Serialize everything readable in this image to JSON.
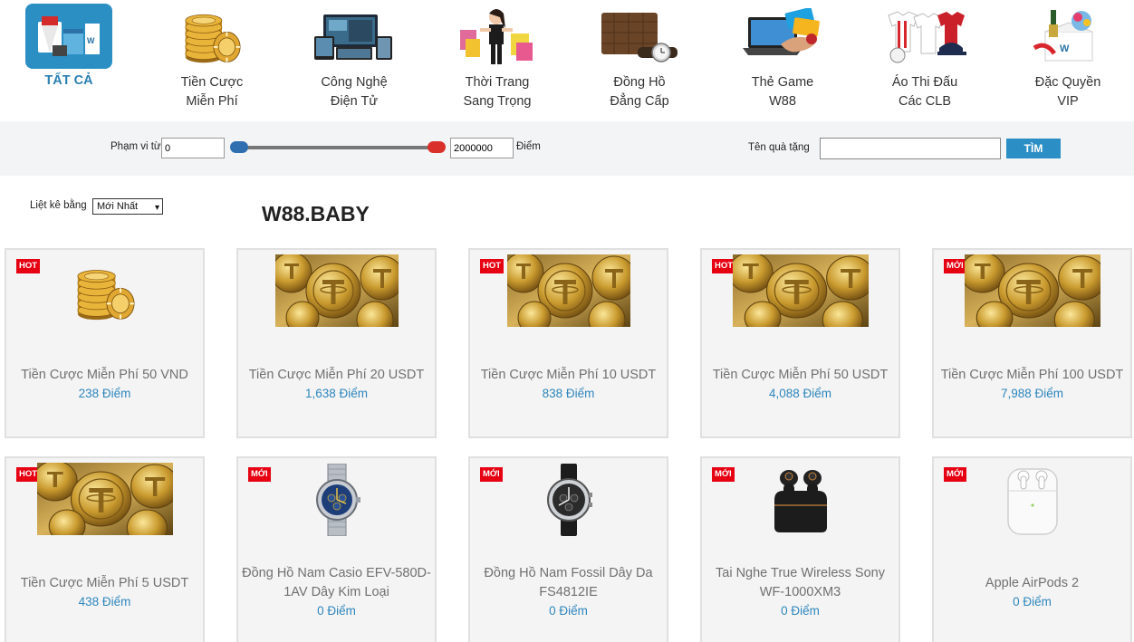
{
  "categories": [
    {
      "label": "TẤT CẢ",
      "icon": "all-gifts-icon",
      "active": true
    },
    {
      "label": "Tiền Cược Miễn Phí",
      "icon": "casino-chips-icon",
      "active": false
    },
    {
      "label": "Công Nghệ Điện Tử",
      "icon": "electronics-icon",
      "active": false
    },
    {
      "label": "Thời Trang Sang Trọng",
      "icon": "fashion-icon",
      "active": false
    },
    {
      "label": "Đồng Hồ Đẳng Cấp",
      "icon": "watch-icon",
      "active": false
    },
    {
      "label": "Thẻ Game W88",
      "icon": "game-card-icon",
      "active": false
    },
    {
      "label": "Áo Thi Đấu Các CLB",
      "icon": "jersey-icon",
      "active": false
    },
    {
      "label": "Đặc Quyền VIP",
      "icon": "vip-gift-icon",
      "active": false
    }
  ],
  "filter": {
    "range_label": "Phạm vi từ",
    "min_value": "0",
    "max_value": "2000000",
    "unit_label": "Điểm",
    "gift_name_label": "Tên quà tặng",
    "gift_name_value": "",
    "search_label": "TÌM"
  },
  "sort": {
    "label": "Liệt kê bằng",
    "selected": "Mới Nhất"
  },
  "brand_title": "W88.BABY",
  "colors": {
    "accent": "#2c8fc4",
    "badge": "#e60012",
    "points": "#2e86bd",
    "range_min_handle": "#2f6fb0",
    "range_max_handle": "#d9302c"
  },
  "products": [
    {
      "badge": "HOT",
      "name": "Tiền Cược Miễn Phí 50 VND",
      "points": "238 Điểm",
      "image": "casino-chips-icon"
    },
    {
      "badge": "",
      "name": "Tiền Cược Miễn Phí 20 USDT",
      "points": "1,638 Điểm",
      "image": "tether-coins-icon"
    },
    {
      "badge": "HOT",
      "name": "Tiền Cược Miễn Phí 10 USDT",
      "points": "838 Điểm",
      "image": "tether-coins-icon"
    },
    {
      "badge": "HOT",
      "name": "Tiền Cược Miễn Phí 50 USDT",
      "points": "4,088 Điểm",
      "image": "tether-coins-icon"
    },
    {
      "badge": "MỚI",
      "name": "Tiền Cược Miễn Phí 100 USDT",
      "points": "7,988 Điểm",
      "image": "tether-coins-icon"
    },
    {
      "badge": "HOT",
      "name": "Tiền Cược Miễn Phí 5 USDT",
      "points": "438 Điểm",
      "image": "tether-coins-icon"
    },
    {
      "badge": "MỚI",
      "name": "Đồng Hồ Nam Casio EFV-580D-1AV Dây Kim Loại",
      "points": "0 Điểm",
      "image": "metal-watch-icon"
    },
    {
      "badge": "MỚI",
      "name": "Đồng Hồ Nam Fossil Dây Da FS4812IE",
      "points": "0 Điểm",
      "image": "leather-watch-icon"
    },
    {
      "badge": "MỚI",
      "name": "Tai Nghe True Wireless Sony WF-1000XM3",
      "points": "0 Điểm",
      "image": "earbuds-icon"
    },
    {
      "badge": "MỚI",
      "name": "Apple AirPods 2",
      "points": "0 Điểm",
      "image": "airpods-icon"
    }
  ]
}
